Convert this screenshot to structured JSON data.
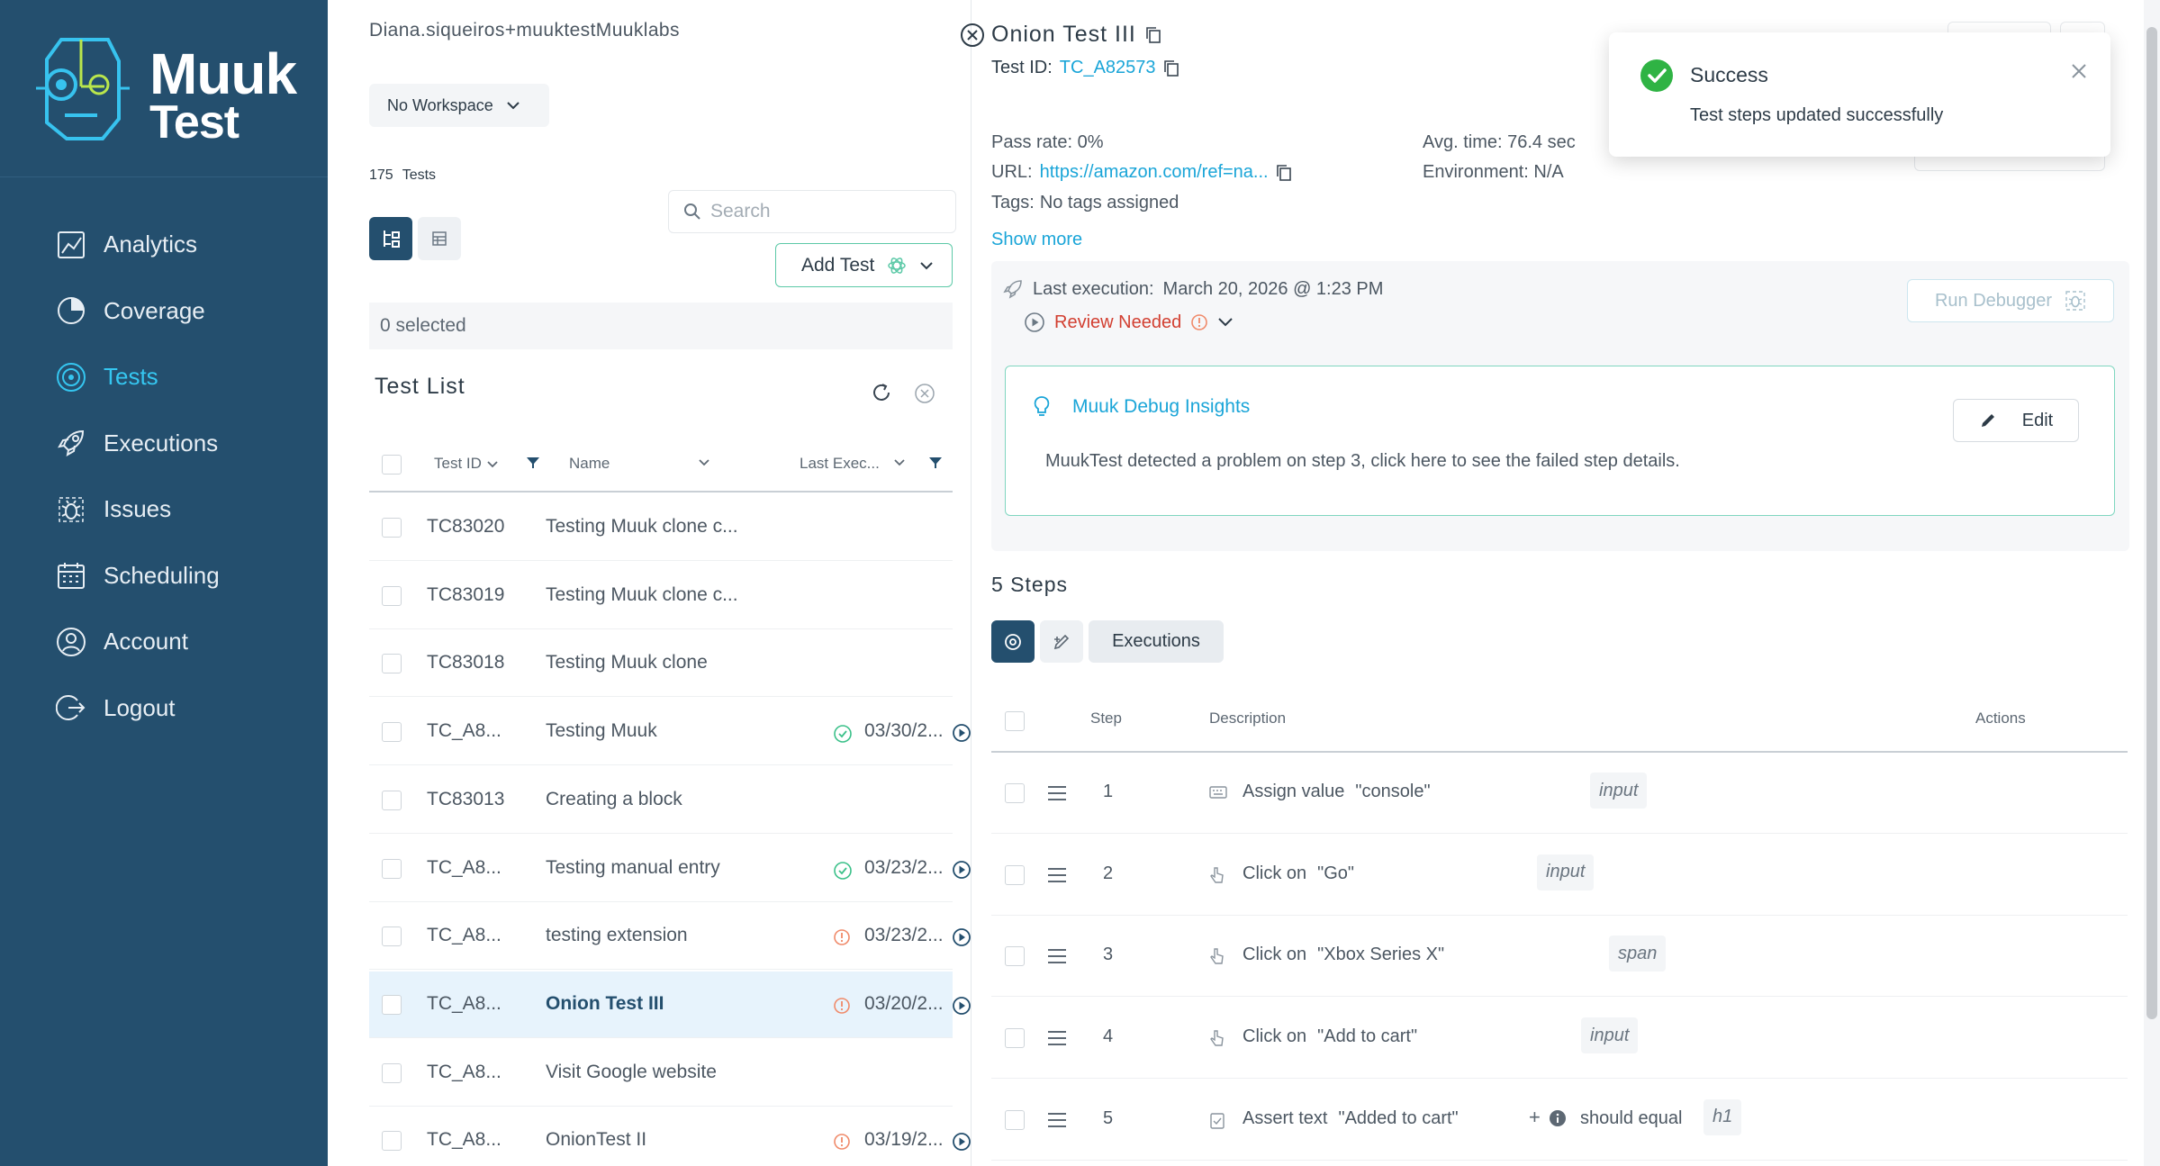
{
  "brand": {
    "line1": "Muuk",
    "line2": "Test"
  },
  "nav": [
    {
      "label": "Analytics",
      "icon": "analytics-icon"
    },
    {
      "label": "Coverage",
      "icon": "coverage-icon"
    },
    {
      "label": "Tests",
      "icon": "tests-icon",
      "active": true
    },
    {
      "label": "Executions",
      "icon": "rocket-icon"
    },
    {
      "label": "Issues",
      "icon": "bug-icon"
    },
    {
      "label": "Scheduling",
      "icon": "calendar-icon"
    },
    {
      "label": "Account",
      "icon": "user-icon"
    },
    {
      "label": "Logout",
      "icon": "logout-icon"
    }
  ],
  "list": {
    "user": "Diana.siqueiros+muuktestMuuklabs",
    "workspace": "No Workspace",
    "count": "175",
    "count_label": "Tests",
    "search_placeholder": "Search",
    "add_test": "Add Test",
    "selected": "0 selected",
    "title": "Test List",
    "columns": {
      "id": "Test ID",
      "name": "Name",
      "last": "Last Exec..."
    },
    "rows": [
      {
        "id": "TC83020",
        "name": "Testing Muuk clone c...",
        "status": "",
        "date": ""
      },
      {
        "id": "TC83019",
        "name": "Testing Muuk clone c...",
        "status": "",
        "date": ""
      },
      {
        "id": "TC83018",
        "name": "Testing Muuk clone",
        "status": "",
        "date": ""
      },
      {
        "id": "TC_A8...",
        "name": "Testing Muuk",
        "status": "ok",
        "date": "03/30/2..."
      },
      {
        "id": "TC83013",
        "name": "Creating a block",
        "status": "",
        "date": ""
      },
      {
        "id": "TC_A8...",
        "name": "Testing manual entry",
        "status": "ok",
        "date": "03/23/2..."
      },
      {
        "id": "TC_A8...",
        "name": "testing extension",
        "status": "warn",
        "date": "03/23/2..."
      },
      {
        "id": "TC_A8...",
        "name": "Onion Test III",
        "status": "warn",
        "date": "03/20/2...",
        "selected": true
      },
      {
        "id": "TC_A8...",
        "name": "Visit Google website",
        "status": "",
        "date": ""
      },
      {
        "id": "TC_A8...",
        "name": "OnionTest II",
        "status": "warn",
        "date": "03/19/2..."
      }
    ]
  },
  "detail": {
    "title": "Onion Test III",
    "test_id_label": "Test ID:",
    "test_id": "TC_A82573",
    "pass_rate": "Pass rate: 0%",
    "avg_time": "Avg. time: 76.4 sec",
    "url_label": "URL:",
    "url": "https://amazon.com/ref=na...",
    "environment": "Environment: N/A",
    "tags_label": "Tags:",
    "tags": "No tags assigned",
    "show_more": "Show more",
    "last_exec_label": "Last execution:",
    "last_exec_date": "March 20, 2026 @ 1:23 PM",
    "review": "Review Needed",
    "run_debugger": "Run Debugger",
    "insights_title": "Muuk Debug Insights",
    "insights_text": "MuukTest detected a problem on step 3, click here to see the failed step details.",
    "edit": "Edit",
    "steps_title": "5 Steps",
    "executions_tab": "Executions",
    "step_columns": {
      "step": "Step",
      "description": "Description",
      "actions": "Actions"
    },
    "steps": [
      {
        "num": "1",
        "action": "Assign value",
        "value": "\"console\"",
        "tag": "input",
        "icon": "keyboard-icon"
      },
      {
        "num": "2",
        "action": "Click on",
        "value": "\"Go\"",
        "tag": "input",
        "icon": "click-icon"
      },
      {
        "num": "3",
        "action": "Click on",
        "value": "\"Xbox Series X\"",
        "tag": "span",
        "icon": "click-icon"
      },
      {
        "num": "4",
        "action": "Click on",
        "value": "\"Add to cart\"",
        "tag": "input",
        "icon": "click-icon"
      },
      {
        "num": "5",
        "action": "Assert text",
        "value": "\"Added to cart\"",
        "extra": "should equal",
        "tag": "h1",
        "icon": "assert-icon"
      }
    ]
  },
  "toast": {
    "title": "Success",
    "message": "Test steps updated successfully"
  }
}
